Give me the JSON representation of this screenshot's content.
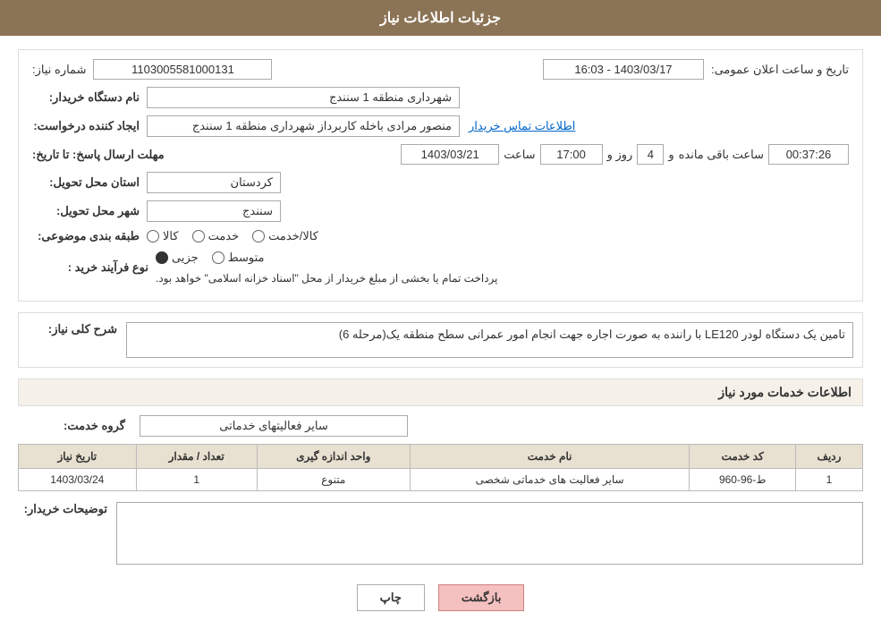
{
  "header": {
    "title": "جزئیات اطلاعات نیاز"
  },
  "fields": {
    "shomara_niaz_label": "شماره نیاز:",
    "shomara_niaz_value": "1103005581000131",
    "nam_dastgah_label": "نام دستگاه خریدار:",
    "nam_dastgah_value": "شهرداری منطقه 1 سنندج",
    "ijad_konande_label": "ایجاد کننده درخواست:",
    "ijad_konande_value": "منصور مرادی باخله کاربرداز شهرداری منطقه 1 سنندج",
    "ettelaat_tamas_label": "اطلاعات تماس خریدار",
    "mohlat_label": "مهلت ارسال پاسخ: تا تاریخ:",
    "date_value": "1403/03/21",
    "saat_label": "ساعت",
    "saat_value": "17:00",
    "roz_label": "روز و",
    "roz_value": "4",
    "saat_mande_label": "ساعت باقی مانده",
    "saat_mande_value": "00:37:26",
    "tarikh_label": "تاریخ و ساعت اعلان عمومی:",
    "tarikh_value": "1403/03/17 - 16:03",
    "ostan_label": "استان محل تحویل:",
    "ostan_value": "کردستان",
    "shahr_label": "شهر محل تحویل:",
    "shahr_value": "سنندج",
    "tabaqe_label": "طبقه بندی موضوعی:",
    "kala_label": "کالا",
    "khedmat_label": "خدمت",
    "kala_khedmat_label": "کالا/خدمت",
    "noye_farayand_label": "نوع فرآیند خرید :",
    "jozvi_label": "جزیی",
    "motavasset_label": "متوسط",
    "note_text": "پرداخت تمام یا بخشی از مبلغ خریدار از محل \"اسناد خزانه اسلامی\" خواهد بود.",
    "sharh_label": "شرح کلی نیاز:",
    "sharh_value": "تامین یک دستگاه لودر LE120 با راننده به صورت اجاره جهت انجام امور عمرانی سطح منطقه یک(مرحله 6)"
  },
  "services_section": {
    "title": "اطلاعات خدمات مورد نیاز",
    "goroh_label": "گروه خدمت:",
    "goroh_value": "سایر فعالیتهای خدماتی",
    "table": {
      "headers": [
        "ردیف",
        "کد خدمت",
        "نام خدمت",
        "واحد اندازه گیری",
        "تعداد / مقدار",
        "تاریخ نیاز"
      ],
      "rows": [
        {
          "radif": "1",
          "kod": "ط-96-960",
          "nam": "سایر فعالیت های خدماتی شخصی",
          "vahed": "متنوع",
          "tedad": "1",
          "tarikh": "1403/03/24"
        }
      ]
    }
  },
  "tawzih": {
    "label": "توضیحات خریدار:",
    "value": ""
  },
  "buttons": {
    "chap": "چاپ",
    "bazgasht": "بازگشت"
  }
}
